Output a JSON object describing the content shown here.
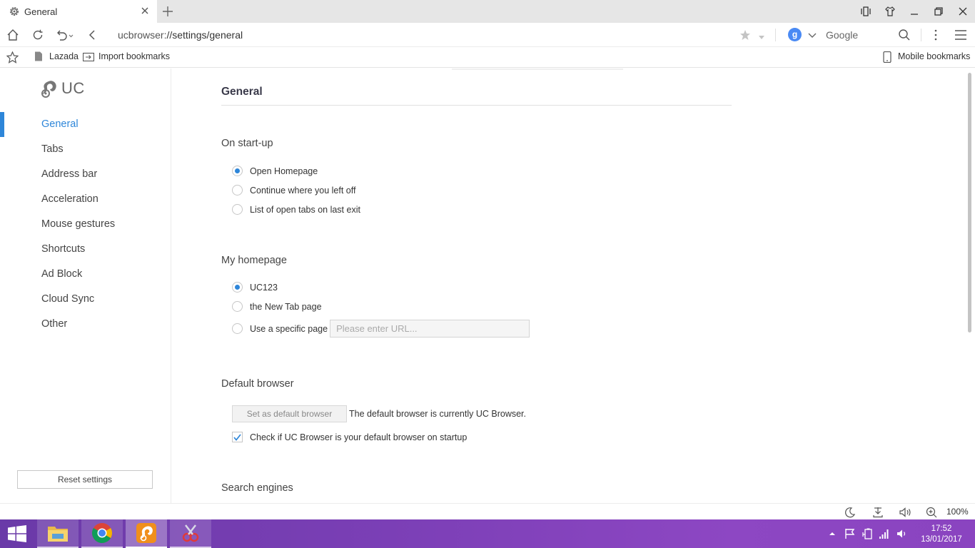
{
  "browser": {
    "tab": {
      "title": "General",
      "icon": "gear-icon",
      "close_icon": "close-icon"
    },
    "new_tab_icon": "plus-icon",
    "window_controls": [
      "sidebar-icon",
      "shirt-skin-icon",
      "minimize-icon",
      "restore-icon",
      "close-window-icon"
    ],
    "address_bar": {
      "url_scheme": "ucbrowser:",
      "url_path": "//settings/general"
    },
    "search_engine": {
      "letter": "g",
      "name": "Google"
    },
    "bookmarks": {
      "items": [
        {
          "label": "Lazada"
        },
        {
          "label": "Import bookmarks"
        }
      ],
      "mobile_label": "Mobile bookmarks"
    }
  },
  "sidebar": {
    "logo_text": "UC",
    "items": [
      {
        "label": "General",
        "active": true
      },
      {
        "label": "Tabs"
      },
      {
        "label": "Address bar"
      },
      {
        "label": "Acceleration"
      },
      {
        "label": "Mouse gestures"
      },
      {
        "label": "Shortcuts"
      },
      {
        "label": "Ad Block"
      },
      {
        "label": "Cloud Sync"
      },
      {
        "label": "Other"
      }
    ],
    "reset_label": "Reset settings"
  },
  "main": {
    "title": "General",
    "startup": {
      "heading": "On start-up",
      "options": [
        {
          "label": "Open Homepage",
          "selected": true
        },
        {
          "label": "Continue where you left off",
          "selected": false
        },
        {
          "label": "List of open tabs on last exit",
          "selected": false
        }
      ]
    },
    "homepage": {
      "heading": "My homepage",
      "options": [
        {
          "label": "UC123",
          "selected": true
        },
        {
          "label": "the New Tab page",
          "selected": false
        },
        {
          "label": "Use a specific page",
          "selected": false
        }
      ],
      "url_placeholder": "Please enter URL..."
    },
    "default_browser": {
      "heading": "Default browser",
      "button_label": "Set as default browser",
      "note": "The default browser is currently UC Browser.",
      "check_label": "Check if UC Browser is your default browser on startup",
      "checked": true
    },
    "search_engines": {
      "heading": "Search engines"
    }
  },
  "statusbar": {
    "zoom": "100%"
  },
  "taskbar": {
    "apps": [
      "file-explorer-icon",
      "chrome-icon",
      "uc-browser-icon",
      "snipping-tool-icon"
    ],
    "time": "17:52",
    "date": "13/01/2017"
  },
  "colors": {
    "accent": "#2e86d9",
    "taskbar": "#7b3fb6"
  }
}
